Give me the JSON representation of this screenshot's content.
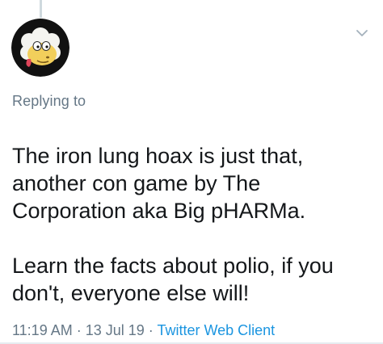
{
  "reply": {
    "label": "Replying to"
  },
  "tweet": {
    "paragraph1": "The iron lung hoax is just that, another con game by The Corporation aka Big pHARMa.",
    "paragraph2": "Learn the facts about polio, if you don't, everyone else will!"
  },
  "meta": {
    "time": "11:19 AM",
    "separator1": " · ",
    "date": "13 Jul 19",
    "separator2": " · ",
    "client": "Twitter Web Client"
  },
  "icons": {
    "avatar": "cartoon-sheep-avatar",
    "caret": "chevron-down-icon"
  },
  "colors": {
    "text": "#14171a",
    "secondary": "#657786",
    "link": "#1b95e0",
    "thread_line": "#cfd9de"
  }
}
